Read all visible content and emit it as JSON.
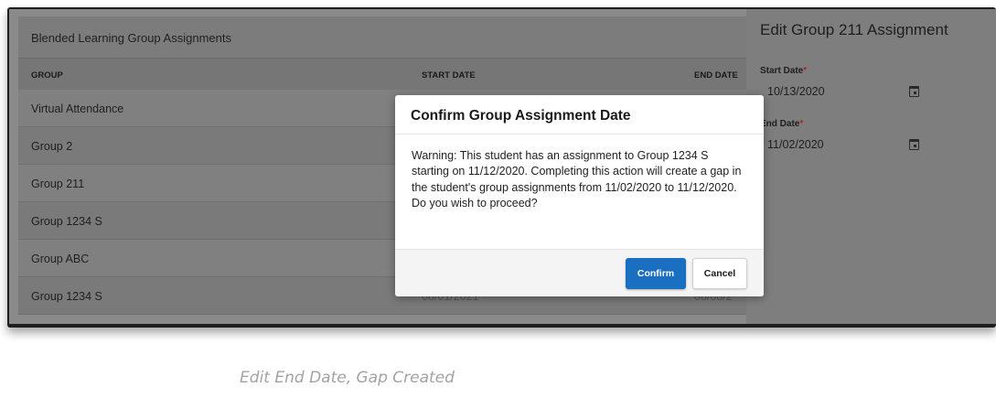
{
  "table": {
    "title": "Blended Learning Group Assignments",
    "columns": {
      "group": "GROUP",
      "start_date": "START DATE",
      "end_date": "END DATE"
    },
    "rows": [
      {
        "group": "Virtual Attendance",
        "start_date": "",
        "end_date": ""
      },
      {
        "group": "Group 2",
        "start_date": "",
        "end_date": ""
      },
      {
        "group": "Group 211",
        "start_date": "",
        "end_date": ""
      },
      {
        "group": "Group 1234 S",
        "start_date": "",
        "end_date": ""
      },
      {
        "group": "Group ABC",
        "start_date": "",
        "end_date": ""
      },
      {
        "group": "Group 1234 S",
        "start_date": "08/01/2021",
        "end_date": "08/08/2"
      }
    ]
  },
  "edit_panel": {
    "title": "Edit Group 211 Assignment",
    "start_label": "Start Date",
    "start_value": "10/13/2020",
    "end_label": "End Date",
    "end_value": "11/02/2020",
    "required_mark": "*"
  },
  "modal": {
    "title": "Confirm Group Assignment Date",
    "message": "Warning: This student has an assignment to Group 1234 S starting on 11/12/2020. Completing this action will create a gap in the student's group assignments from 11/02/2020 to 11/12/2020. Do you wish to proceed?",
    "confirm_label": "Confirm",
    "cancel_label": "Cancel"
  },
  "caption": "Edit End Date, Gap Created",
  "colors": {
    "confirm_button": "#1a6fc0",
    "required": "#b3261e",
    "overlay": "#8a8a8a"
  },
  "icons": [
    "calendar-icon"
  ]
}
